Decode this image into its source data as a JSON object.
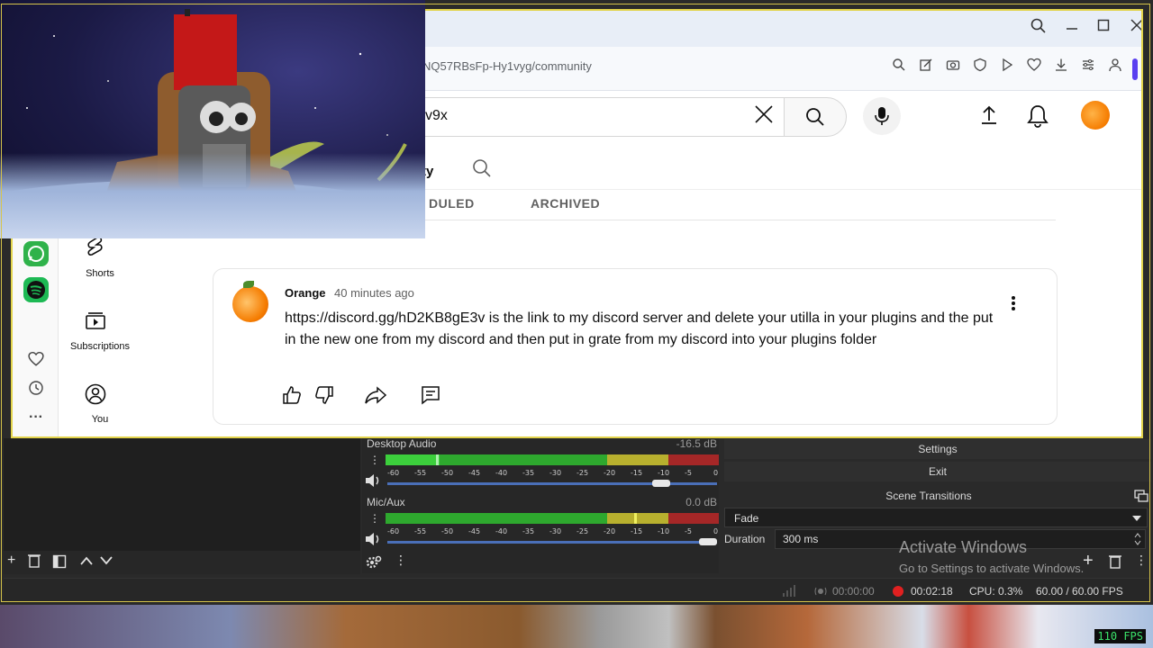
{
  "browser": {
    "url_fragment": "NQ57RBsFp-Hy1vyg/community",
    "window_controls": [
      "search",
      "minimize",
      "maximize",
      "close"
    ]
  },
  "youtube": {
    "search_value": "v9x",
    "tabs": {
      "community_partial": "ty",
      "scheduled_partial": "DULED",
      "archived": "ARCHIVED"
    },
    "guide": [
      {
        "label": "Shorts",
        "icon": "shorts-icon"
      },
      {
        "label": "Subscriptions",
        "icon": "subscriptions-icon"
      },
      {
        "label": "You",
        "icon": "you-icon"
      }
    ],
    "post": {
      "author": "Orange",
      "time": "40 minutes ago",
      "text": "https://discord.gg/hD2KB8gE3v is the link to my discord server and delete your utilla in your plugins and the put in the new one from my discord and then put in grate from my discord into your plugins folder"
    }
  },
  "obs": {
    "mixer": [
      {
        "name": "Desktop Audio",
        "db": "-16.5 dB",
        "level": 0.85
      },
      {
        "name": "Mic/Aux",
        "db": "0.0 dB",
        "level": 1.0
      }
    ],
    "meter_scale": [
      "-60",
      "-55",
      "-50",
      "-45",
      "-40",
      "-35",
      "-30",
      "-25",
      "-20",
      "-15",
      "-10",
      "-5",
      "0"
    ],
    "controls": {
      "settings": "Settings",
      "exit": "Exit",
      "scene_transitions": "Scene Transitions",
      "transition": "Fade",
      "duration_label": "Duration",
      "duration_value": "300 ms"
    },
    "status": {
      "stream_time": "00:00:00",
      "rec_time": "00:02:18",
      "cpu": "CPU: 0.3%",
      "fps": "60.00 / 60.00 FPS"
    },
    "watermark": {
      "title": "Activate Windows",
      "sub": "Go to Settings to activate Windows."
    }
  },
  "overlay_fps": "110 FPS",
  "colors": {
    "obs_border": "#d7c54a",
    "meter_green": "#2ea82e",
    "meter_yellow": "#b8b02e",
    "meter_red": "#a52727",
    "rec_red": "#e02020"
  }
}
